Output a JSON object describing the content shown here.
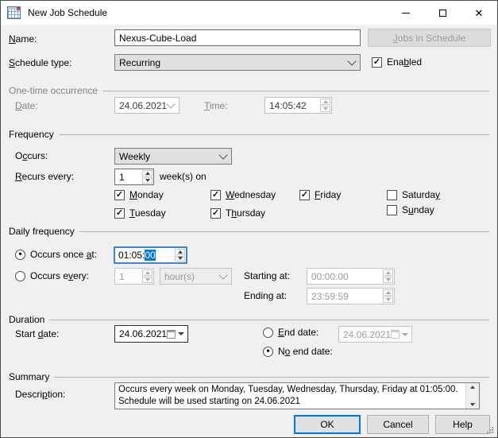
{
  "window": {
    "title": "New Job Schedule"
  },
  "icons": {
    "close": "✕"
  },
  "header": {
    "name_label": {
      "text": "Name:",
      "u": 0
    },
    "name_value": "Nexus-Cube-Load",
    "jobs_button": {
      "text": "Jobs in Schedule",
      "u": 0
    },
    "type_label": {
      "text": "Schedule type:",
      "u": 0
    },
    "type_value": "Recurring",
    "enabled_label": {
      "text": "Enabled",
      "u": 3
    },
    "enabled_mark": "✓"
  },
  "one_time": {
    "title": "One-time occurrence",
    "date_label": {
      "text": "Date:",
      "u": 0
    },
    "date_value": "24.06.2021",
    "time_label": {
      "text": "Time:",
      "u": 0
    },
    "time_value": "14:05:42"
  },
  "frequency": {
    "title": "Frequency",
    "occurs_label": {
      "text": "Occurs:",
      "u": 1
    },
    "occurs_value": "Weekly",
    "recurs_label": {
      "text": "Recurs every:",
      "u": 0
    },
    "recurs_value": "1",
    "recurs_suffix": "week(s) on",
    "days": [
      {
        "label": {
          "text": "Monday",
          "u": 0
        },
        "mark": "✓"
      },
      {
        "label": {
          "text": "Tuesday",
          "u": 0
        },
        "mark": "✓"
      },
      {
        "label": {
          "text": "Wednesday",
          "u": 0
        },
        "mark": "✓"
      },
      {
        "label": {
          "text": "Thursday",
          "u": 1
        },
        "mark": "✓"
      },
      {
        "label": {
          "text": "Friday",
          "u": 0
        },
        "mark": "✓"
      },
      {
        "label": {
          "text": "Saturday",
          "u": 7
        },
        "mark": ""
      },
      {
        "label": {
          "text": "Sunday",
          "u": 1
        },
        "mark": ""
      }
    ]
  },
  "daily": {
    "title": "Daily frequency",
    "once_label": {
      "text": "Occurs once at:",
      "u": 12
    },
    "once_mark": "●",
    "once_time_prefix": "01:05:",
    "once_time_selected": "00",
    "every_label": {
      "text": "Occurs every:",
      "u": 8
    },
    "every_mark": "",
    "every_value": "1",
    "every_unit": "hour(s)",
    "starting_label": {
      "text": "Starting at:",
      "u": 7
    },
    "starting_value": "00:00:00",
    "ending_label": {
      "text": "Ending at:",
      "u": 5
    },
    "ending_value": "23:59:59"
  },
  "duration": {
    "title": "Duration",
    "start_label": {
      "text": "Start date:",
      "u": 6
    },
    "start_value": "24.06.2021",
    "end_label": {
      "text": "End date:",
      "u": 0
    },
    "end_mark": "",
    "end_value": "24.06.2021",
    "noend_label": {
      "text": "No end date:",
      "u": 1
    },
    "noend_mark": "●"
  },
  "summary": {
    "title": "Summary",
    "desc_label": {
      "text": "Description:",
      "u": 6
    },
    "desc_text": "Occurs every week on Monday, Tuesday, Wednesday, Thursday, Friday at 01:05:00. Schedule will be used starting on 24.06.2021"
  },
  "buttons": {
    "ok": "OK",
    "cancel": "Cancel",
    "help": "Help"
  }
}
